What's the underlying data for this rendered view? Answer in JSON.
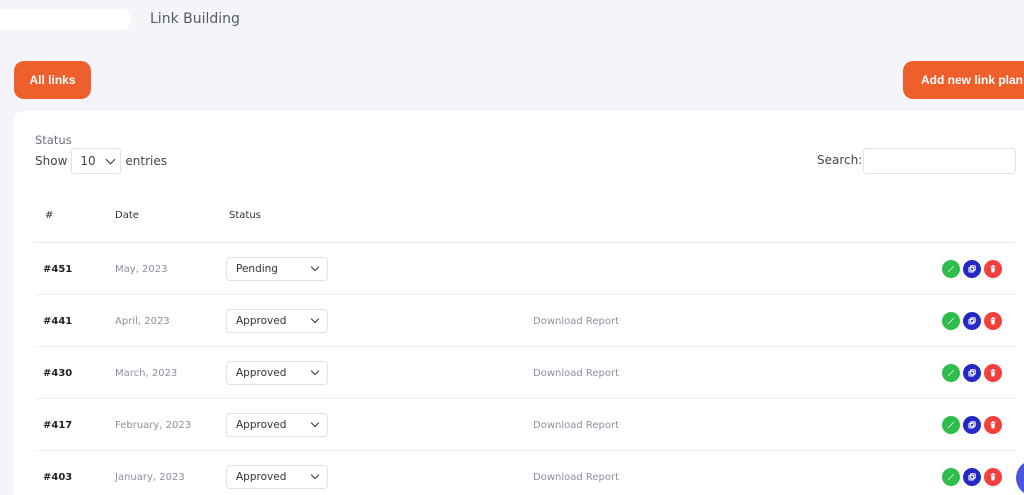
{
  "header": {
    "title": "Link Building"
  },
  "buttons": {
    "all_links": "All links",
    "add_new": "Add new link plan"
  },
  "filters": {
    "status_label": "Status",
    "show_label": "Show",
    "entries_value": "10",
    "entries_label": "entries",
    "search_label": "Search:",
    "search_value": ""
  },
  "table": {
    "columns": [
      "#",
      "Date",
      "Status"
    ],
    "rows": [
      {
        "id": "#451",
        "date": "May, 2023",
        "status": "Pending",
        "report": ""
      },
      {
        "id": "#441",
        "date": "April, 2023",
        "status": "Approved",
        "report": "Download Report"
      },
      {
        "id": "#430",
        "date": "March, 2023",
        "status": "Approved",
        "report": "Download Report"
      },
      {
        "id": "#417",
        "date": "February, 2023",
        "status": "Approved",
        "report": "Download Report"
      },
      {
        "id": "#403",
        "date": "January, 2023",
        "status": "Approved",
        "report": "Download Report"
      }
    ]
  },
  "colors": {
    "accent": "#ee5f2c",
    "edit": "#2ebd4b",
    "copy": "#2528c9",
    "delete": "#f2403d"
  },
  "icons": {
    "edit": "pencil-icon",
    "copy": "copy-icon",
    "delete": "trash-icon"
  }
}
